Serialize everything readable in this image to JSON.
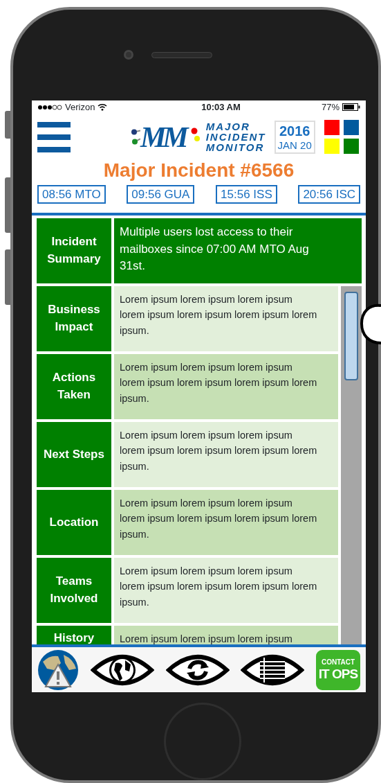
{
  "status_bar": {
    "carrier": "Verizon",
    "time": "10:03 AM",
    "battery": "77%"
  },
  "header": {
    "logo_mark": "MM",
    "logo_words": [
      "MAJOR",
      "INCIDENT",
      "MONITOR"
    ],
    "year": "2016",
    "date": "JAN 20",
    "tiles": [
      {
        "color": "#ff0000"
      },
      {
        "color": "#005a9e"
      },
      {
        "color": "#ffff00"
      },
      {
        "color": "#008000"
      }
    ]
  },
  "title": "Major Incident #6566",
  "clocks": [
    "08:56 MTO",
    "09:56 GUA",
    "15:56 ISS",
    "20:56 ISC"
  ],
  "rows": [
    {
      "kind": "summary",
      "label": "Incident Summary",
      "text": "Multiple users lost access to their mailboxes since 07:00 AM MTO Aug 31st."
    },
    {
      "kind": "detail",
      "label": "Business Impact",
      "text": "Lorem ipsum lorem ipsum lorem ipsum lorem ipsum lorem ipsum lorem ipsum lorem ipsum."
    },
    {
      "kind": "detail",
      "label": "Actions Taken",
      "text": "Lorem ipsum lorem ipsum lorem ipsum lorem ipsum lorem ipsum lorem ipsum lorem ipsum."
    },
    {
      "kind": "detail",
      "label": "Next Steps",
      "text": "Lorem ipsum lorem ipsum lorem ipsum lorem ipsum lorem ipsum lorem ipsum lorem ipsum."
    },
    {
      "kind": "detail",
      "label": "Location",
      "text": "Lorem ipsum lorem ipsum lorem ipsum lorem ipsum lorem ipsum lorem ipsum lorem ipsum."
    },
    {
      "kind": "detail",
      "label": "Teams Involved",
      "text": "Lorem ipsum lorem ipsum lorem ipsum lorem ipsum lorem ipsum lorem ipsum lorem ipsum."
    },
    {
      "kind": "partial",
      "label": "History",
      "text": "Lorem ipsum lorem ipsum lorem ipsum"
    }
  ],
  "toolbar": [
    {
      "kind": "globe-alert"
    },
    {
      "kind": "eye-globe"
    },
    {
      "kind": "eye-refresh"
    },
    {
      "kind": "eye-list"
    },
    {
      "kind": "contact",
      "top": "CONTACT",
      "bottom": "IT OPS"
    }
  ]
}
